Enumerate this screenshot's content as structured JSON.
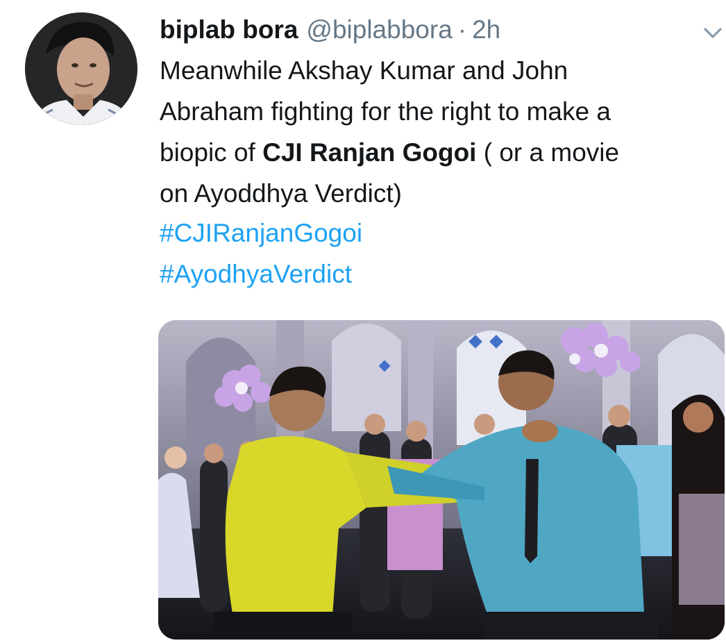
{
  "tweet": {
    "author_name": "biplab bora",
    "handle": "@biplabbora",
    "separator": "·",
    "time": "2h",
    "text_line1": "Meanwhile Akshay Kumar and John",
    "text_line2": "Abraham fighting for the right to make a",
    "text_line3_pre": "biopic of ",
    "text_line3_bold": "CJI Ranjan Gogoi",
    "text_line3_post": " ( or a movie",
    "text_line4": "on Ayoddhya Verdict)",
    "hashtags": [
      "#CJIRanjanGogoi",
      "#AyodhyaVerdict"
    ]
  },
  "icons": {
    "menu": "chevron-down-icon",
    "avatar": "avatar"
  },
  "colors": {
    "text": "#14171a",
    "secondary": "#657786",
    "link": "#1da1f2",
    "background": "#ffffff"
  }
}
